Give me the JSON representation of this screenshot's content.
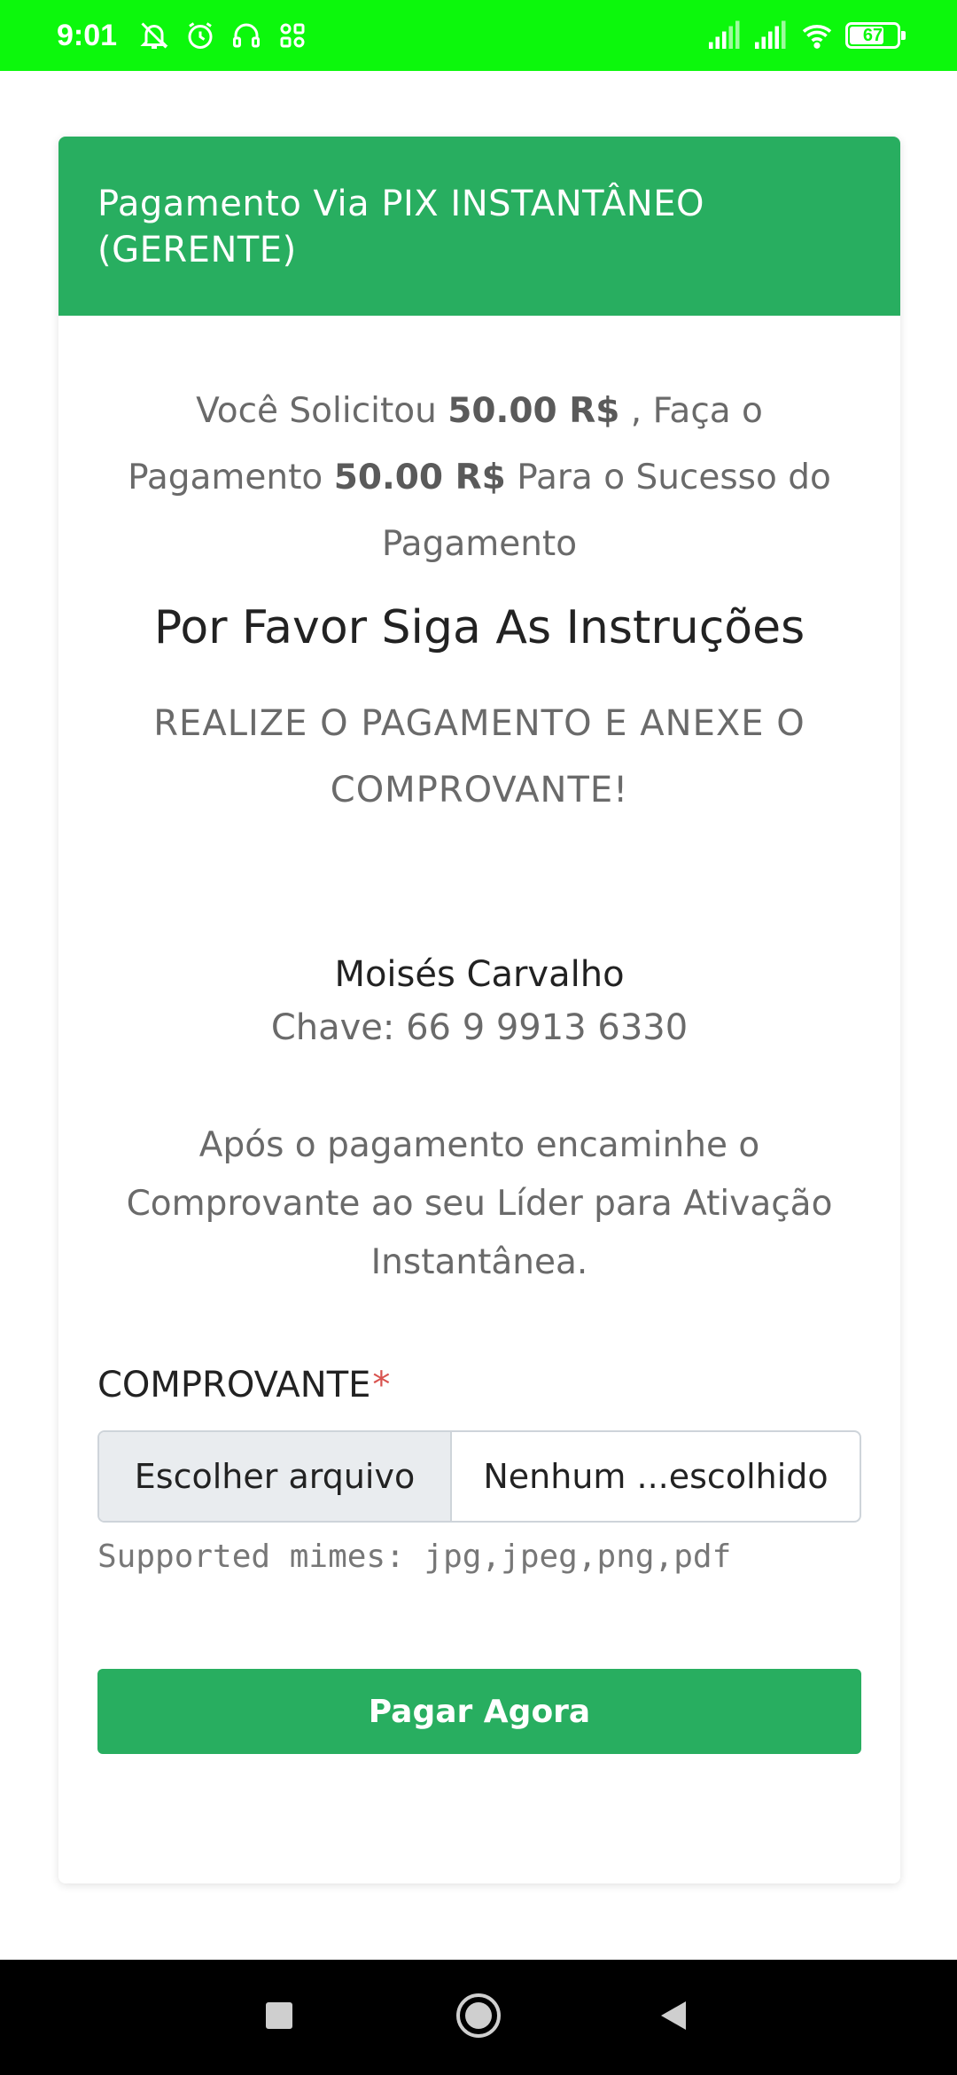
{
  "status_bar": {
    "time": "9:01",
    "battery": "67",
    "icons": [
      "bell-off-icon",
      "alarm-icon",
      "headset-icon",
      "apps-icon",
      "signal-icon",
      "signal-icon",
      "wifi-icon",
      "battery-icon"
    ]
  },
  "card": {
    "title": "Pagamento Via PIX INSTANTÂNEO (GERENTE)",
    "intro": {
      "p1": "Você Solicitou ",
      "amount1": "50.00 R$",
      "p2": " , Faça o Pagamento ",
      "amount2": "50.00 R$",
      "p3": " Para o Sucesso do Pagamento"
    },
    "instructions_title": "Por Favor Siga As Instruções",
    "instructions_text": "REALIZE O PAGAMENTO E ANEXE O COMPROVANTE!",
    "pix_name": "Moisés Carvalho",
    "pix_key": "Chave: 66 9 9913 6330",
    "after_payment": "Após o pagamento encaminhe o Comprovante ao seu Líder para Ativação Instantânea.",
    "receipt_label": "COMPROVANTE",
    "required_mark": "*",
    "file_button": "Escolher arquivo",
    "file_status": "Nenhum ...escolhido",
    "hint": "Supported mimes: jpg,jpeg,png,pdf",
    "pay_button": "Pagar Agora"
  },
  "colors": {
    "status_bar": "#0cf80c",
    "header": "#28ae60",
    "button": "#28ae60",
    "required": "#d9534f"
  }
}
